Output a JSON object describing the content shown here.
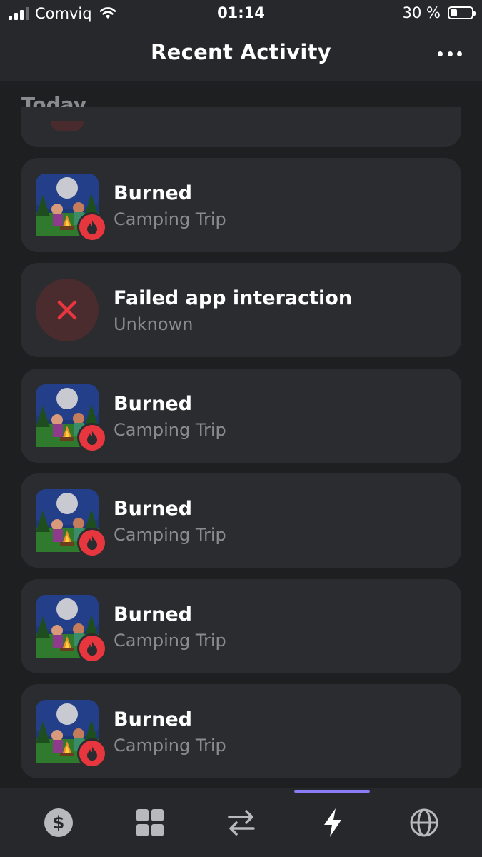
{
  "status_bar": {
    "carrier": "Comviq",
    "time": "01:14",
    "battery": "30 %"
  },
  "header": {
    "title": "Recent Activity",
    "more_icon": "more-horizontal-icon"
  },
  "section": {
    "title": "Today"
  },
  "activities": [
    {
      "title": "Burned",
      "subtitle": "Camping Trip",
      "icon": "camping-trip-thumbnail",
      "badge": "fire-icon"
    },
    {
      "title": "Failed app interaction",
      "subtitle": "Unknown",
      "icon": "x-icon"
    },
    {
      "title": "Burned",
      "subtitle": "Camping Trip",
      "icon": "camping-trip-thumbnail",
      "badge": "fire-icon"
    },
    {
      "title": "Burned",
      "subtitle": "Camping Trip",
      "icon": "camping-trip-thumbnail",
      "badge": "fire-icon"
    },
    {
      "title": "Burned",
      "subtitle": "Camping Trip",
      "icon": "camping-trip-thumbnail",
      "badge": "fire-icon"
    },
    {
      "title": "Burned",
      "subtitle": "Camping Trip",
      "icon": "camping-trip-thumbnail",
      "badge": "fire-icon"
    }
  ],
  "tab_bar": {
    "tabs": [
      {
        "icon": "dollar-icon",
        "active": false
      },
      {
        "icon": "grid-icon",
        "active": false
      },
      {
        "icon": "transfer-icon",
        "active": false
      },
      {
        "icon": "lightning-icon",
        "active": true
      },
      {
        "icon": "globe-icon",
        "active": false
      }
    ]
  },
  "colors": {
    "background": "#1e1f21",
    "card": "#2b2c30",
    "accent": "#8a7cf5",
    "burn_red": "#e8363f",
    "muted_text": "#8a8b8e"
  }
}
